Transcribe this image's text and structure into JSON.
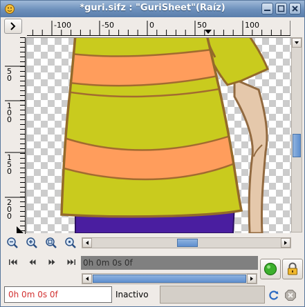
{
  "window": {
    "title": "*guri.sifz : \"GuriSheet\"(Raíz)"
  },
  "ruler": {
    "h_labels": [
      "-100",
      "-50",
      "0",
      "50",
      "100"
    ],
    "v_labels": [
      "5\n0",
      "1\n0\n0",
      "1\n5\n0",
      "2\n0\n0"
    ]
  },
  "icons": {
    "nav": "chevron-right-icon",
    "zoom_out": "zoom-out-icon",
    "zoom_in": "zoom-in-icon",
    "zoom_fit": "zoom-fit-icon",
    "zoom_reset": "zoom-100-icon",
    "seek_begin": "seek-begin-icon",
    "prev_frame": "prev-keyframe-icon",
    "next_frame": "next-keyframe-icon",
    "seek_end": "seek-end-icon",
    "animate_mode": "record-icon",
    "lock": "lock-icon",
    "refresh": "refresh-icon",
    "stop": "stop-icon"
  },
  "timebar": {
    "current_time": "0h 0m 0s 0f"
  },
  "statusbar": {
    "time_field": "0h 0m 0s 0f",
    "status_label": "Inactivo"
  },
  "colors": {
    "accent": "#5f8fcf",
    "title_gradient_top": "#9fb9d8",
    "shirt_yellow": "#c9cb1e",
    "stripe_orange": "#ff9d5c",
    "outline_brown": "#946a2a",
    "record_green": "#3cb02c"
  }
}
